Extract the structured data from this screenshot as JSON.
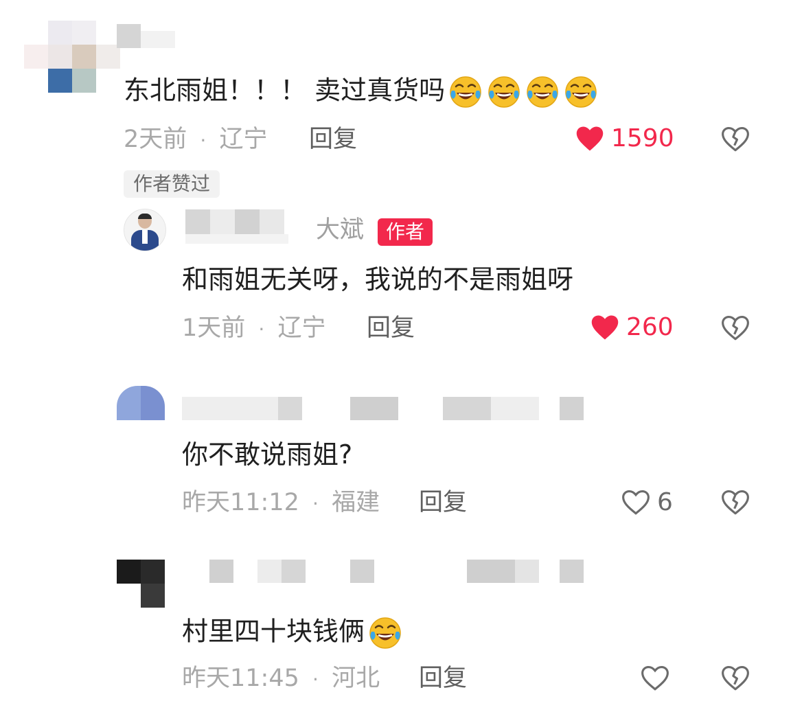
{
  "comments": [
    {
      "text": "东北雨姐！！！ 卖过真货吗",
      "emoji_count": 4,
      "time": "2天前",
      "sep": "·",
      "location": "辽宁",
      "reply_label": "回复",
      "likes": "1590",
      "liked": true,
      "tag": "作者赞过"
    },
    {
      "name_suffix": "大斌",
      "badge": "作者",
      "text": "和雨姐无关呀，我说的不是雨姐呀",
      "time": "1天前",
      "sep": "·",
      "location": "辽宁",
      "reply_label": "回复",
      "likes": "260",
      "liked": true
    },
    {
      "text": "你不敢说雨姐?",
      "time": "昨天11:12",
      "sep": "·",
      "location": "福建",
      "reply_label": "回复",
      "likes": "6",
      "liked": false
    },
    {
      "text": "村里四十块钱俩",
      "emoji_count": 1,
      "time": "昨天11:45",
      "sep": "·",
      "location": "河北",
      "reply_label": "回复",
      "likes": "",
      "liked": false
    }
  ],
  "colors": {
    "like_active": "#f2284c",
    "like_inactive": "#6b6b6b",
    "meta": "#a8a8a8",
    "text": "#1f1f1f",
    "badge": "#f2284c"
  },
  "icons": {
    "like": "heart-icon",
    "dislike": "broken-heart-icon",
    "emoji": "laughing-crying-emoji"
  }
}
